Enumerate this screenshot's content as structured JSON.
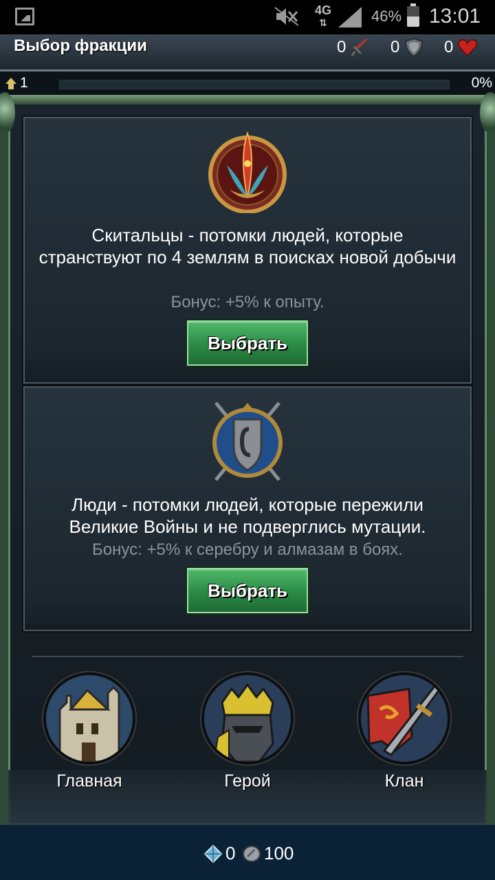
{
  "status_bar": {
    "battery": "46%",
    "time": "13:01",
    "network": "4G"
  },
  "header": {
    "title": "Выбор фракции",
    "attack": "0",
    "defense": "0",
    "health": "0"
  },
  "xp": {
    "level": "1",
    "percent_label": "0%",
    "progress": 0
  },
  "factions": [
    {
      "description": "Скитальцы - потомки людей, которые странствуют по 4 землям в поисках новой добычи",
      "bonus": "Бонус: +5% к опыту.",
      "button": "Выбрать"
    },
    {
      "description": "Люди - потомки людей, которые пережили Великие Войны и не подверглись мутации.",
      "bonus": "Бонус: +5% к серебру и алмазам в боях.",
      "button": "Выбрать"
    }
  ],
  "nav": [
    {
      "label": "Главная"
    },
    {
      "label": "Герой"
    },
    {
      "label": "Клан"
    }
  ],
  "bottom": {
    "diamonds": "0",
    "silver": "100"
  },
  "colors": {
    "button_green": "#2a8a44",
    "frame_green": "#2f4a36",
    "bottom_bar": "#0b2136"
  }
}
